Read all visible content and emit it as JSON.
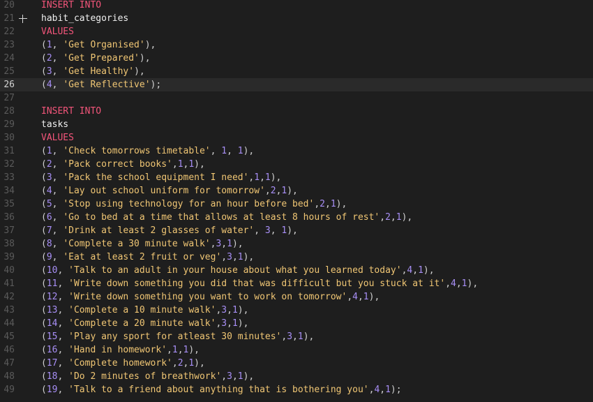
{
  "editor": {
    "colors": {
      "background": "#1e1e1e",
      "current_line": "#2a2a2a",
      "keyword": "#f2557a",
      "string": "#f0c674",
      "number": "#a88ff6",
      "identifier": "#f0f0f0"
    },
    "current_line": 26,
    "add_icon_line": 21,
    "lines": [
      {
        "n": "20",
        "tokens": [
          [
            "kw",
            "INSERT INTO"
          ]
        ]
      },
      {
        "n": "21",
        "tokens": [
          [
            "id",
            "habit_categories"
          ]
        ]
      },
      {
        "n": "22",
        "tokens": [
          [
            "kw",
            "VALUES"
          ]
        ]
      },
      {
        "n": "23",
        "tokens": [
          [
            "pn",
            "("
          ],
          [
            "num",
            "1"
          ],
          [
            "pn",
            ", "
          ],
          [
            "str",
            "'Get Organised'"
          ],
          [
            "pn",
            "),"
          ]
        ]
      },
      {
        "n": "24",
        "tokens": [
          [
            "pn",
            "("
          ],
          [
            "num",
            "2"
          ],
          [
            "pn",
            ", "
          ],
          [
            "str",
            "'Get Prepared'"
          ],
          [
            "pn",
            "),"
          ]
        ]
      },
      {
        "n": "25",
        "tokens": [
          [
            "pn",
            "("
          ],
          [
            "num",
            "3"
          ],
          [
            "pn",
            ", "
          ],
          [
            "str",
            "'Get Healthy'"
          ],
          [
            "pn",
            "),"
          ]
        ]
      },
      {
        "n": "26",
        "tokens": [
          [
            "pn",
            "("
          ],
          [
            "num",
            "4"
          ],
          [
            "pn",
            ", "
          ],
          [
            "str",
            "'Get Reflective'"
          ],
          [
            "pn",
            ");"
          ]
        ]
      },
      {
        "n": "27",
        "tokens": []
      },
      {
        "n": "28",
        "tokens": [
          [
            "kw",
            "INSERT INTO"
          ]
        ]
      },
      {
        "n": "29",
        "tokens": [
          [
            "id",
            "tasks"
          ]
        ]
      },
      {
        "n": "30",
        "tokens": [
          [
            "kw",
            "VALUES"
          ]
        ]
      },
      {
        "n": "31",
        "tokens": [
          [
            "pn",
            "("
          ],
          [
            "num",
            "1"
          ],
          [
            "pn",
            ", "
          ],
          [
            "str",
            "'Check tomorrows timetable'"
          ],
          [
            "pn",
            ", "
          ],
          [
            "num",
            "1"
          ],
          [
            "pn",
            ", "
          ],
          [
            "num",
            "1"
          ],
          [
            "pn",
            "),"
          ]
        ]
      },
      {
        "n": "32",
        "tokens": [
          [
            "pn",
            "("
          ],
          [
            "num",
            "2"
          ],
          [
            "pn",
            ", "
          ],
          [
            "str",
            "'Pack correct books'"
          ],
          [
            "pn",
            ","
          ],
          [
            "num",
            "1"
          ],
          [
            "pn",
            ","
          ],
          [
            "num",
            "1"
          ],
          [
            "pn",
            "),"
          ]
        ]
      },
      {
        "n": "33",
        "tokens": [
          [
            "pn",
            "("
          ],
          [
            "num",
            "3"
          ],
          [
            "pn",
            ", "
          ],
          [
            "str",
            "'Pack the school equipment I need'"
          ],
          [
            "pn",
            ","
          ],
          [
            "num",
            "1"
          ],
          [
            "pn",
            ","
          ],
          [
            "num",
            "1"
          ],
          [
            "pn",
            "),"
          ]
        ]
      },
      {
        "n": "34",
        "tokens": [
          [
            "pn",
            "("
          ],
          [
            "num",
            "4"
          ],
          [
            "pn",
            ", "
          ],
          [
            "str",
            "'Lay out school uniform for tomorrow'"
          ],
          [
            "pn",
            ","
          ],
          [
            "num",
            "2"
          ],
          [
            "pn",
            ","
          ],
          [
            "num",
            "1"
          ],
          [
            "pn",
            "),"
          ]
        ]
      },
      {
        "n": "35",
        "tokens": [
          [
            "pn",
            "("
          ],
          [
            "num",
            "5"
          ],
          [
            "pn",
            ", "
          ],
          [
            "str",
            "'Stop using technology for an hour before bed'"
          ],
          [
            "pn",
            ","
          ],
          [
            "num",
            "2"
          ],
          [
            "pn",
            ","
          ],
          [
            "num",
            "1"
          ],
          [
            "pn",
            "),"
          ]
        ]
      },
      {
        "n": "36",
        "tokens": [
          [
            "pn",
            "("
          ],
          [
            "num",
            "6"
          ],
          [
            "pn",
            ", "
          ],
          [
            "str",
            "'Go to bed at a time that allows at least 8 hours of rest'"
          ],
          [
            "pn",
            ","
          ],
          [
            "num",
            "2"
          ],
          [
            "pn",
            ","
          ],
          [
            "num",
            "1"
          ],
          [
            "pn",
            "),"
          ]
        ]
      },
      {
        "n": "37",
        "tokens": [
          [
            "pn",
            "("
          ],
          [
            "num",
            "7"
          ],
          [
            "pn",
            ", "
          ],
          [
            "str",
            "'Drink at least 2 glasses of water'"
          ],
          [
            "pn",
            ", "
          ],
          [
            "num",
            "3"
          ],
          [
            "pn",
            ", "
          ],
          [
            "num",
            "1"
          ],
          [
            "pn",
            "),"
          ]
        ]
      },
      {
        "n": "38",
        "tokens": [
          [
            "pn",
            "("
          ],
          [
            "num",
            "8"
          ],
          [
            "pn",
            ", "
          ],
          [
            "str",
            "'Complete a 30 minute walk'"
          ],
          [
            "pn",
            ","
          ],
          [
            "num",
            "3"
          ],
          [
            "pn",
            ","
          ],
          [
            "num",
            "1"
          ],
          [
            "pn",
            "),"
          ]
        ]
      },
      {
        "n": "39",
        "tokens": [
          [
            "pn",
            "("
          ],
          [
            "num",
            "9"
          ],
          [
            "pn",
            ", "
          ],
          [
            "str",
            "'Eat at least 2 fruit or veg'"
          ],
          [
            "pn",
            ","
          ],
          [
            "num",
            "3"
          ],
          [
            "pn",
            ","
          ],
          [
            "num",
            "1"
          ],
          [
            "pn",
            "),"
          ]
        ]
      },
      {
        "n": "40",
        "tokens": [
          [
            "pn",
            "("
          ],
          [
            "num",
            "10"
          ],
          [
            "pn",
            ", "
          ],
          [
            "str",
            "'Talk to an adult in your house about what you learned today'"
          ],
          [
            "pn",
            ","
          ],
          [
            "num",
            "4"
          ],
          [
            "pn",
            ","
          ],
          [
            "num",
            "1"
          ],
          [
            "pn",
            "),"
          ]
        ]
      },
      {
        "n": "41",
        "tokens": [
          [
            "pn",
            "("
          ],
          [
            "num",
            "11"
          ],
          [
            "pn",
            ", "
          ],
          [
            "str",
            "'Write down something you did that was difficult but you stuck at it'"
          ],
          [
            "pn",
            ","
          ],
          [
            "num",
            "4"
          ],
          [
            "pn",
            ","
          ],
          [
            "num",
            "1"
          ],
          [
            "pn",
            "),"
          ]
        ]
      },
      {
        "n": "42",
        "tokens": [
          [
            "pn",
            "("
          ],
          [
            "num",
            "12"
          ],
          [
            "pn",
            ", "
          ],
          [
            "str",
            "'Write down something you want to work on tomorrow'"
          ],
          [
            "pn",
            ","
          ],
          [
            "num",
            "4"
          ],
          [
            "pn",
            ","
          ],
          [
            "num",
            "1"
          ],
          [
            "pn",
            "),"
          ]
        ]
      },
      {
        "n": "43",
        "tokens": [
          [
            "pn",
            "("
          ],
          [
            "num",
            "13"
          ],
          [
            "pn",
            ", "
          ],
          [
            "str",
            "'Complete a 10 minute walk'"
          ],
          [
            "pn",
            ","
          ],
          [
            "num",
            "3"
          ],
          [
            "pn",
            ","
          ],
          [
            "num",
            "1"
          ],
          [
            "pn",
            "),"
          ]
        ]
      },
      {
        "n": "44",
        "tokens": [
          [
            "pn",
            "("
          ],
          [
            "num",
            "14"
          ],
          [
            "pn",
            ", "
          ],
          [
            "str",
            "'Complete a 20 minute walk'"
          ],
          [
            "pn",
            ","
          ],
          [
            "num",
            "3"
          ],
          [
            "pn",
            ","
          ],
          [
            "num",
            "1"
          ],
          [
            "pn",
            "),"
          ]
        ]
      },
      {
        "n": "45",
        "tokens": [
          [
            "pn",
            "("
          ],
          [
            "num",
            "15"
          ],
          [
            "pn",
            ", "
          ],
          [
            "str",
            "'Play any sport for atleast 30 minutes'"
          ],
          [
            "pn",
            ","
          ],
          [
            "num",
            "3"
          ],
          [
            "pn",
            ","
          ],
          [
            "num",
            "1"
          ],
          [
            "pn",
            "),"
          ]
        ]
      },
      {
        "n": "46",
        "tokens": [
          [
            "pn",
            "("
          ],
          [
            "num",
            "16"
          ],
          [
            "pn",
            ", "
          ],
          [
            "str",
            "'Hand in homework'"
          ],
          [
            "pn",
            ","
          ],
          [
            "num",
            "1"
          ],
          [
            "pn",
            ","
          ],
          [
            "num",
            "1"
          ],
          [
            "pn",
            "),"
          ]
        ]
      },
      {
        "n": "47",
        "tokens": [
          [
            "pn",
            "("
          ],
          [
            "num",
            "17"
          ],
          [
            "pn",
            ", "
          ],
          [
            "str",
            "'Complete homework'"
          ],
          [
            "pn",
            ","
          ],
          [
            "num",
            "2"
          ],
          [
            "pn",
            ","
          ],
          [
            "num",
            "1"
          ],
          [
            "pn",
            "),"
          ]
        ]
      },
      {
        "n": "48",
        "tokens": [
          [
            "pn",
            "("
          ],
          [
            "num",
            "18"
          ],
          [
            "pn",
            ", "
          ],
          [
            "str",
            "'Do 2 minutes of breathwork'"
          ],
          [
            "pn",
            ","
          ],
          [
            "num",
            "3"
          ],
          [
            "pn",
            ","
          ],
          [
            "num",
            "1"
          ],
          [
            "pn",
            "),"
          ]
        ]
      },
      {
        "n": "49",
        "tokens": [
          [
            "pn",
            "("
          ],
          [
            "num",
            "19"
          ],
          [
            "pn",
            ", "
          ],
          [
            "str",
            "'Talk to a friend about anything that is bothering you'"
          ],
          [
            "pn",
            ","
          ],
          [
            "num",
            "4"
          ],
          [
            "pn",
            ","
          ],
          [
            "num",
            "1"
          ],
          [
            "pn",
            ");"
          ]
        ]
      }
    ]
  }
}
